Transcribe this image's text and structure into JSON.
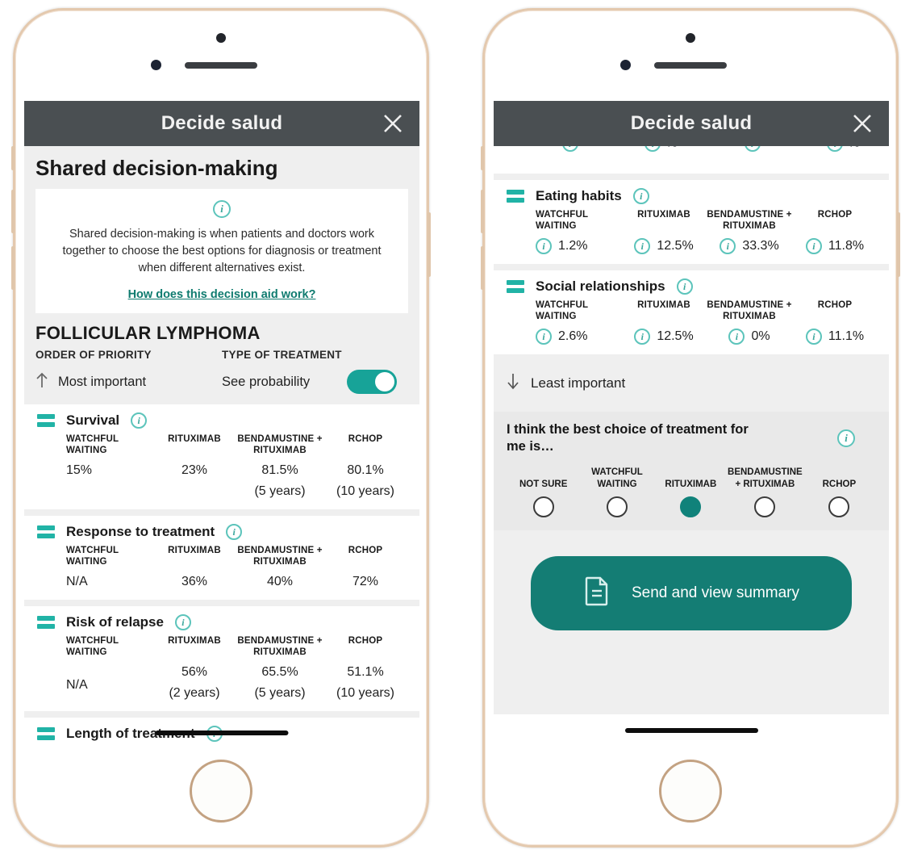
{
  "app": {
    "title": "Decide salud",
    "close_icon": "close-icon",
    "accent_teal": "#17a398",
    "header_bg": "#4a4f52",
    "link_color": "#0f7b6f"
  },
  "left": {
    "page_title": "Shared decision-making",
    "info_icon": "info-icon",
    "info_text": "Shared decision-making is when patients and doctors work together to choose the best options for diagnosis or treatment when different alternatives exist.",
    "info_link": "How does this decision aid work?",
    "disease_title": "FOLLICULAR LYMPHOMA",
    "controls": {
      "priority_label": "ORDER OF PRIORITY",
      "priority_value": "Most important",
      "priority_icon": "arrow-up-icon",
      "treatment_label": "TYPE OF TREATMENT",
      "toggle_label": "See probability",
      "toggle_state": "on"
    },
    "columns": [
      "WATCHFUL WAITING",
      "RITUXIMAB",
      "BENDAMUSTINE + RITUXIMAB",
      "RCHOP"
    ],
    "rows": [
      {
        "name": "Survival",
        "values": [
          "15%",
          "23%",
          "81.5%",
          "80.1%"
        ],
        "notes": [
          "",
          "",
          "(5 years)",
          "(10 years)"
        ]
      },
      {
        "name": "Response to treatment",
        "values": [
          "N/A",
          "36%",
          "40%",
          "72%"
        ],
        "notes": [
          "",
          "",
          "",
          ""
        ]
      },
      {
        "name": "Risk of relapse",
        "values": [
          "N/A",
          "56%",
          "65.5%",
          "51.1%"
        ],
        "notes": [
          "",
          "(2 years)",
          "(5 years)",
          "(10 years)"
        ]
      },
      {
        "name": "Length of treatment",
        "values": [
          "",
          "",
          "",
          ""
        ],
        "notes": [
          "",
          "",
          "",
          ""
        ]
      }
    ]
  },
  "right": {
    "columns": [
      "WATCHFUL WAITING",
      "RITUXIMAB",
      "BENDAMUSTINE + RITUXIMAB",
      "RCHOP"
    ],
    "clipped_row": {
      "fragments": [
        "",
        "%",
        "",
        "%"
      ]
    },
    "rows": [
      {
        "name": "Eating habits",
        "values": [
          "1.2%",
          "12.5%",
          "33.3%",
          "11.8%"
        ]
      },
      {
        "name": "Social relationships",
        "values": [
          "2.6%",
          "12.5%",
          "0%",
          "11.1%"
        ]
      }
    ],
    "least_important": "Least important",
    "least_icon": "arrow-down-icon",
    "choice": {
      "title": "I think the best choice of treatment for me is…",
      "options": [
        "NOT SURE",
        "WATCHFUL WAITING",
        "RITUXIMAB",
        "BENDAMUSTINE + RITUXIMAB",
        "RCHOP"
      ],
      "selected": "RITUXIMAB"
    },
    "send_button": {
      "label": "Send and view summary",
      "icon": "document-icon"
    }
  }
}
